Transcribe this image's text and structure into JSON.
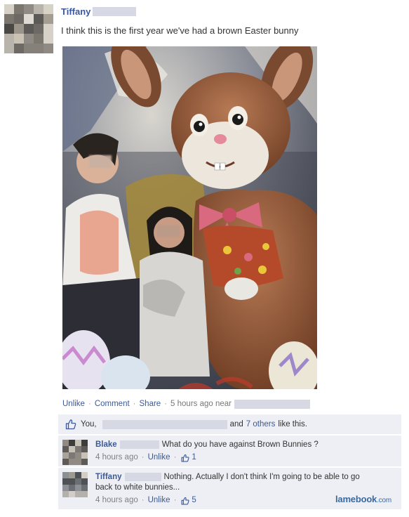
{
  "post": {
    "author": "Tiffany",
    "text": "I think this is the first year we've had a brown Easter bunny",
    "photo_alt": "photo"
  },
  "actions": {
    "unlike": "Unlike",
    "comment": "Comment",
    "share": "Share",
    "time": "5 hours ago near"
  },
  "likes": {
    "you": "You,",
    "and": "and",
    "others": "7 others",
    "suffix": "like this."
  },
  "comments": [
    {
      "author": "Blake",
      "text": "What do you have against Brown Bunnies ?",
      "time": "4 hours ago",
      "unlike": "Unlike",
      "likes": "1"
    },
    {
      "author": "Tiffany",
      "text": "Nothing. Actually I don't think I'm going to be able to go back to white bunnies...",
      "time": "4 hours ago",
      "unlike": "Unlike",
      "likes": "5"
    }
  ],
  "watermark": {
    "brand": "lamebook",
    "tld": ".com"
  },
  "colors": {
    "link": "#3b5998",
    "feedback_bg": "#edeff4",
    "redaction": "#d6d9e3"
  },
  "icons": {
    "like": "thumbs-up-icon"
  }
}
